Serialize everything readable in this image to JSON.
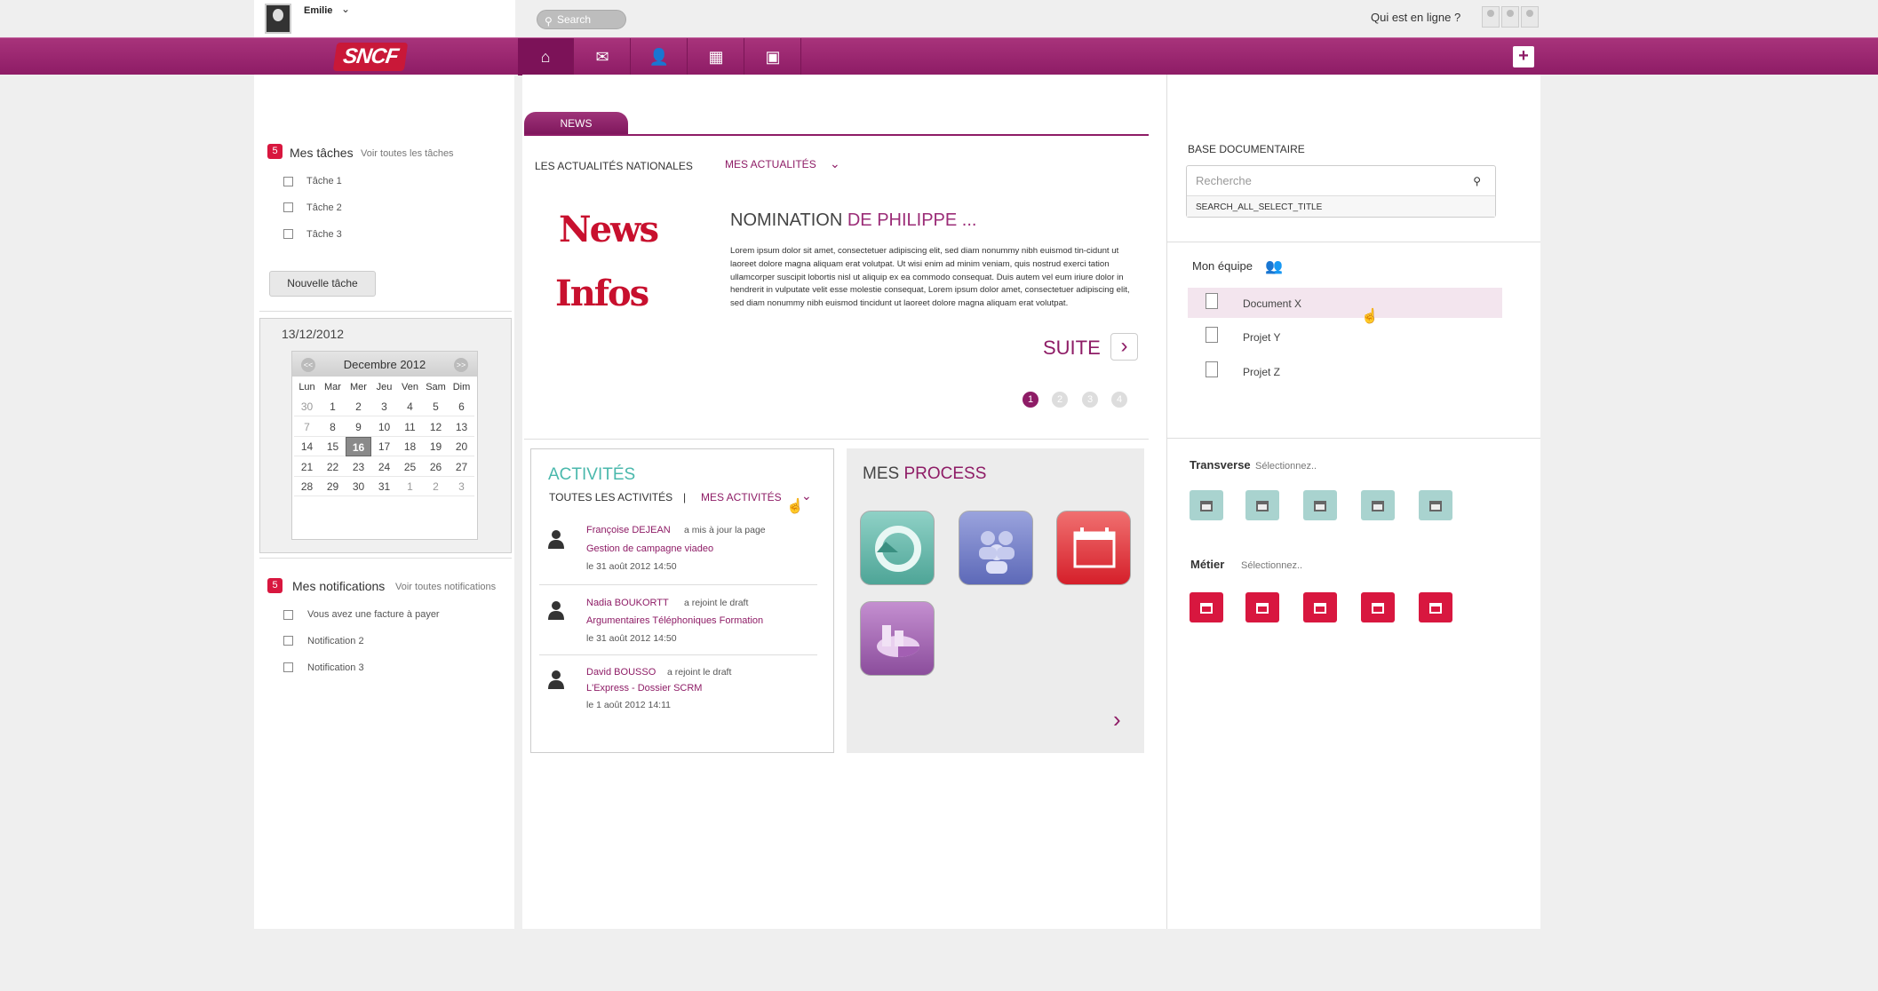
{
  "user": {
    "name": "Emilie"
  },
  "search": {
    "placeholder": "Search"
  },
  "online": {
    "label": "Qui est en ligne ?"
  },
  "brand": {
    "logo_text": "SNCF",
    "accent": "#8e1c66",
    "red": "#d8173f",
    "teal": "#4ab8ac"
  },
  "nav": {
    "icons": [
      "home-icon",
      "mail-icon",
      "user-add-icon",
      "calendar-icon",
      "chat-icon"
    ],
    "plus": "+"
  },
  "tasks": {
    "count": "5",
    "title": "Mes tâches",
    "link": "Voir toutes les tâches",
    "items": [
      "Tâche 1",
      "Tâche 2",
      "Tâche 3"
    ],
    "new_button": "Nouvelle tâche"
  },
  "calendar": {
    "date": "13/12/2012",
    "month": "Decembre 2012",
    "prev": "<<",
    "next": ">>",
    "dow": [
      "Lun",
      "Mar",
      "Mer",
      "Jeu",
      "Ven",
      "Sam",
      "Dim"
    ],
    "weeks": [
      [
        "30",
        "1",
        "2",
        "3",
        "4",
        "5",
        "6"
      ],
      [
        "7",
        "8",
        "9",
        "10",
        "11",
        "12",
        "13"
      ],
      [
        "14",
        "15",
        "16",
        "17",
        "18",
        "19",
        "20"
      ],
      [
        "21",
        "22",
        "23",
        "24",
        "25",
        "26",
        "27"
      ],
      [
        "28",
        "29",
        "30",
        "31",
        "1",
        "2",
        "3"
      ]
    ],
    "today": "16"
  },
  "notifications": {
    "count": "5",
    "title": "Mes notifications",
    "link": "Voir toutes notifications",
    "items": [
      "Vous avez une facture à payer",
      "Notification 2",
      "Notification 3"
    ]
  },
  "news": {
    "tab": "NEWS",
    "tab_national": "LES ACTUALITÉS NATIONALES",
    "tab_mine": "MES ACTUALITÉS",
    "image_words": [
      "News",
      "Infos"
    ],
    "title_a": "NOMINATION",
    "title_b": "DE PHILIPPE ...",
    "body": "Lorem ipsum dolor sit amet, consectetuer adipiscing elit, sed diam nonummy nibh euismod tin-cidunt ut laoreet dolore magna aliquam erat volutpat. Ut wisi enim ad minim veniam, quis nostrud exerci tation ullamcorper suscipit lobortis nisl ut aliquip ex ea commodo consequat. Duis autem vel eum iriure dolor in hendrerit in vulputate velit esse molestie consequat, Lorem ipsum dolor amet, consectetuer adipiscing elit, sed diam nonummy nibh euismod tincidunt ut laoreet dolore magna aliquam erat volutpat.",
    "more": "SUITE",
    "pages": [
      "1",
      "2",
      "3",
      "4"
    ]
  },
  "activities": {
    "title": "ACTIVITÉS",
    "tab_all": "TOUTES LES ACTIVITÉS",
    "divider": "|",
    "tab_mine": "MES ACTIVITÉS",
    "items": [
      {
        "name": "Françoise DEJEAN",
        "verb": "a mis à jour la page",
        "link": "Gestion de campagne viadeo",
        "date": "le 31 août 2012 14:50"
      },
      {
        "name": "Nadia BOUKORTT",
        "verb": "a rejoint le draft",
        "link": "Argumentaires Téléphoniques Formation",
        "date": "le 31 août 2012 14:50"
      },
      {
        "name": "David BOUSSO",
        "verb": "a rejoint le draft",
        "link": "L'Express - Dossier SCRM",
        "date": "le 1 août 2012 14:11"
      }
    ]
  },
  "process": {
    "title_a": "MES",
    "title_b": "PROCESS",
    "icons": [
      "refresh-process-icon",
      "group-process-icon",
      "calendar-process-icon",
      "chart-process-icon"
    ]
  },
  "base": {
    "title": "BASE DOCUMENTAIRE",
    "placeholder": "Recherche",
    "select": "SEARCH_ALL_SELECT_TITLE"
  },
  "team": {
    "title": "Mon équipe",
    "items": [
      "Document X",
      "Projet Y",
      "Projet Z"
    ]
  },
  "transverse": {
    "title": "Transverse",
    "select": "Sélectionnez.."
  },
  "metier": {
    "title": "Métier",
    "select": "Sélectionnez.."
  }
}
